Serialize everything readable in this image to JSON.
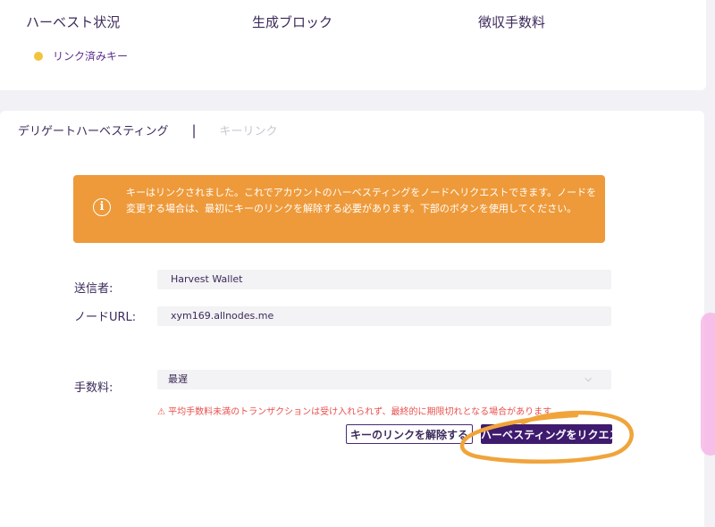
{
  "stats": {
    "harvest_status_label": "ハーベスト状況",
    "blocks_label": "生成ブロック",
    "fees_label": "徴収手数料",
    "legend": {
      "linked_key_label": "リンク済みキー",
      "color": "#f3c33f"
    }
  },
  "tabs": [
    {
      "label": "デリゲートハーベスティング",
      "active": true
    },
    {
      "label": "キーリンク",
      "active": false
    }
  ],
  "tab_separator": "|",
  "alert": {
    "icon": "info-icon",
    "glyph": "i",
    "message": "キーはリンクされました。これでアカウントのハーベスティングをノードへリクエストできます。ノードを変更する場合は、最初にキーのリンクを解除する必要があります。下部のボタンを使用してください。",
    "color": "#ee9a3a"
  },
  "form": {
    "sender_label": "送信者:",
    "sender_value": "Harvest Wallet",
    "node_url_label": "ノードURL:",
    "node_url_value": "xym169.allnodes.me",
    "fee_label": "手数料:",
    "fee_selected": "最遅"
  },
  "warning": "⚠ 平均手数料未満のトランザクションは受け入れられず、最終的に期限切れとなる場合があります",
  "buttons": {
    "unlink_label": "キーのリンクを解除する",
    "request_label": "ハーベスティングをリクエスト"
  },
  "colors": {
    "primary": "#3e1b6e",
    "warning": "#e8504c",
    "annotation": "#f0a43a"
  }
}
